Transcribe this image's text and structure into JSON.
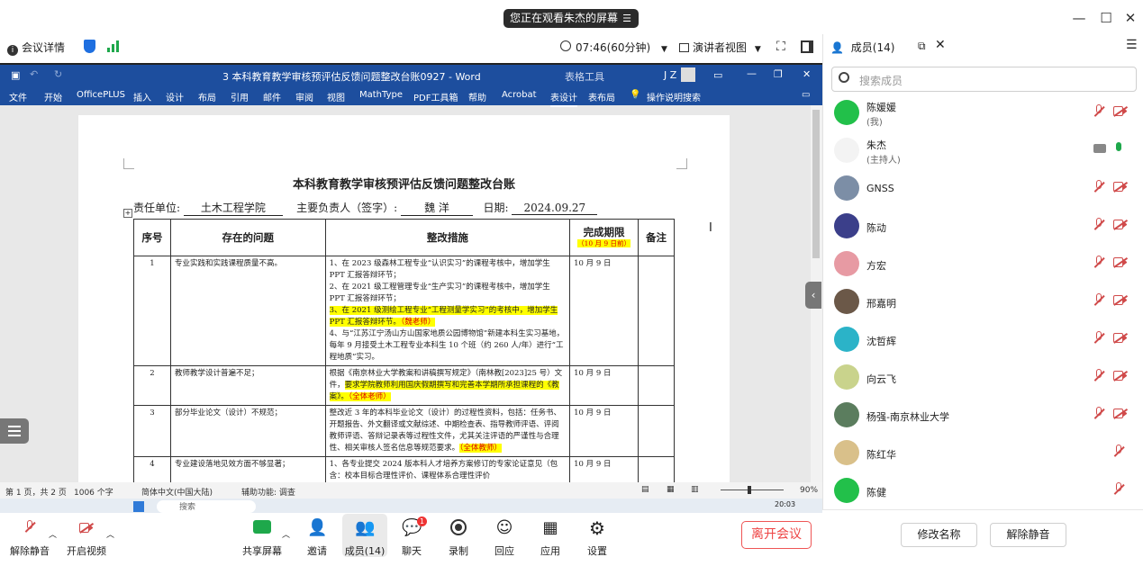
{
  "share_banner": {
    "text": "您正在观看朱杰的屏幕",
    "icon": "menu-icon"
  },
  "meeting_bar": {
    "info_label": "会议详情",
    "timer": "07:46(60分钟)",
    "view_label": "演讲者视图"
  },
  "word": {
    "doc_title": "3 本科教育教学审核预评估反馈问题整改台账0927 - Word",
    "context_tab": "表格工具",
    "user_initials": "J Z",
    "menu": [
      "文件",
      "开始",
      "OfficePLUS",
      "插入",
      "设计",
      "布局",
      "引用",
      "邮件",
      "审阅",
      "视图",
      "MathType",
      "PDF工具箱",
      "帮助",
      "Acrobat",
      "表设计",
      "表布局"
    ],
    "tell_me": "操作说明搜索",
    "status": {
      "pages": "第 1 页，共 2 页",
      "words": "1006 个字",
      "lang": "简体中文(中国大陆)",
      "access": "辅助功能: 调查",
      "zoom": "90%"
    },
    "taskbar_time": "20:03",
    "taskbar_search": "搜索"
  },
  "document": {
    "title": "本科教育教学审核预评估反馈问题整改台账",
    "resp_unit_label": "责任单位:",
    "resp_unit": "土木工程学院",
    "leader_label": "主要负责人（签字）:",
    "leader": "魏 洋",
    "date_label": "日期:",
    "date": "2024.09.27",
    "headers": {
      "no": "序号",
      "problem": "存在的问题",
      "measures": "整改措施",
      "deadline": "完成期限",
      "deadline_note": "（10 月 9 日前）",
      "remark": "备注"
    },
    "rows": [
      {
        "no": "1",
        "problem": "专业实践和实践课程质量不高。",
        "m1": "1、在 2023 级森林工程专业“认识实习”的课程考核中，增加学生 PPT 汇报答辩环节；",
        "m2": "2、在 2021 级工程管理专业“生产实习”的课程考核中，增加学生 PPT 汇报答辩环节；",
        "m3_hl": "3、在 2021 级测绘工程专业“工程测量学实习”的考核中，增加学生 PPT 汇报答辩环节。",
        "m3_red": "（魏老师）",
        "m4": "4、与“江苏江宁汤山方山国家地质公园博物馆”新建本科生实习基地，每年 9 月接受土木工程专业本科生 10 个班（约 260 人/年）进行“工程地质”实习。",
        "deadline": "10 月 9 日"
      },
      {
        "no": "2",
        "problem": "教师教学设计普遍不足；",
        "m1": "根据《南京林业大学教案和讲稿撰写规定》（南林教[2023]25 号）文件，",
        "m3_hl": "要求学院教师利用国庆假期撰写和完善本学期所承担课程的《教案》。",
        "m3_red": "（全体老师）",
        "deadline": "10 月 9 日"
      },
      {
        "no": "3",
        "problem": "部分毕业论文（设计）不规范；",
        "m1": "整改近 3 年的本科毕业论文（设计）的过程性资料，包括：任务书、开题报告、外文翻译或文献综述、中期检查表、指导教师评语、评阅教师评语、答辩记录表等过程性文件，尤其关注评语的严谨性与合理性、相关审核人签名信息等规范要求。",
        "m3_red": "（全体教师）",
        "deadline": "10 月 9 日"
      },
      {
        "no": "4",
        "problem": "专业建设落地见效方面不够显著；",
        "m1": "1、各专业提交 2024 版本科人才培养方案修订的专家论证意见（包含：校本目标合理性评价、课程体系合理性评价",
        "deadline": "10 月 9 日"
      }
    ]
  },
  "panel": {
    "title": "成员(14)",
    "search_placeholder": "搜索成员",
    "members": [
      {
        "name": "陈媛媛",
        "role": "(我)",
        "color": "#22c04a"
      },
      {
        "name": "朱杰",
        "role": "(主持人)",
        "color": "#f3f3f3"
      },
      {
        "name": "GNSS",
        "role": "",
        "color": "#7c8ea6"
      },
      {
        "name": "陈动",
        "role": "",
        "color": "#3b3f8a"
      },
      {
        "name": "方宏",
        "role": "",
        "color": "#e79aa3"
      },
      {
        "name": "邢嘉明",
        "role": "",
        "color": "#6b5848"
      },
      {
        "name": "沈哲辉",
        "role": "",
        "color": "#2bb3c8"
      },
      {
        "name": "向云飞",
        "role": "",
        "color": "#c9d38c"
      },
      {
        "name": "杨强-南京林业大学",
        "role": "",
        "color": "#5b7d5e"
      },
      {
        "name": "陈红华",
        "role": "",
        "color": "#d9c08a"
      },
      {
        "name": "陈健",
        "role": "",
        "color": "#22c04a"
      }
    ],
    "rename_button": "修改名称",
    "unmute_button": "解除静音"
  },
  "toolbar": {
    "unmute": "解除静音",
    "video": "开启视频",
    "share": "共享屏幕",
    "invite": "邀请",
    "members": "成员(14)",
    "chat": "聊天",
    "chat_badge": "1",
    "record": "录制",
    "reply": "回应",
    "apps": "应用",
    "settings": "设置",
    "leave": "离开会议"
  },
  "colors": {
    "word_blue": "#1d4e9e",
    "highlight": "#ffff00",
    "leave_red": "#e44",
    "mute_red": "#d04a4a"
  }
}
